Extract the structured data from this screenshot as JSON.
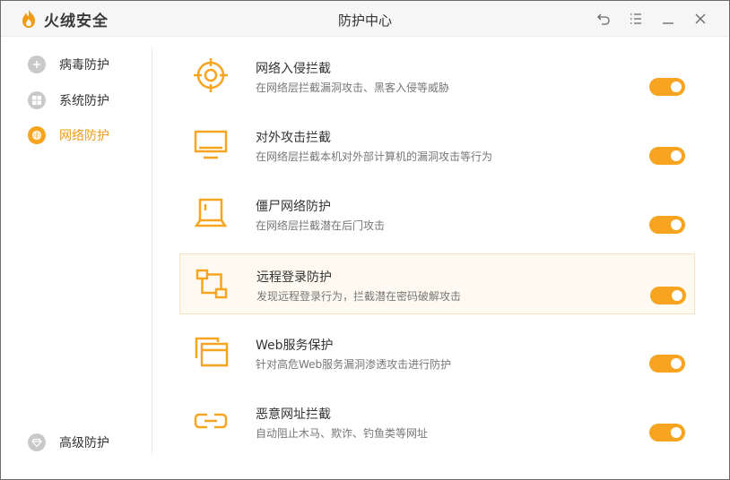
{
  "app": {
    "brand": "火绒安全",
    "title": "防护中心"
  },
  "window_controls": [
    "back-icon",
    "menu-icon",
    "minimize-icon",
    "close-icon"
  ],
  "colors": {
    "accent": "#f7a521",
    "inactive_icon": "#c9c9c9"
  },
  "sidebar": {
    "items": [
      {
        "label": "病毒防护",
        "icon": "virus-shield-icon",
        "active": false
      },
      {
        "label": "系统防护",
        "icon": "windows-icon",
        "active": false
      },
      {
        "label": "网络防护",
        "icon": "globe-icon",
        "active": true
      }
    ],
    "bottom_item": {
      "label": "高级防护",
      "icon": "diamond-icon",
      "active": false
    }
  },
  "rows": [
    {
      "title": "网络入侵拦截",
      "desc": "在网络层拦截漏洞攻击、黑客入侵等威胁",
      "icon": "crosshair-icon",
      "enabled": true
    },
    {
      "title": "对外攻击拦截",
      "desc": "在网络层拦截本机对外部计算机的漏洞攻击等行为",
      "icon": "monitor-icon",
      "enabled": true
    },
    {
      "title": "僵尸网络防护",
      "desc": "在网络层拦截潜在后门攻击",
      "icon": "laptop-icon",
      "enabled": true
    },
    {
      "title": "远程登录防护",
      "desc": "发现远程登录行为，拦截潜在密码破解攻击",
      "icon": "remote-connection-icon",
      "enabled": true,
      "highlighted": true
    },
    {
      "title": "Web服务保护",
      "desc": "针对高危Web服务漏洞渗透攻击进行防护",
      "icon": "web-windows-icon",
      "enabled": true
    },
    {
      "title": "恶意网址拦截",
      "desc": "自动阻止木马、欺诈、钓鱼类等网址",
      "icon": "link-icon",
      "enabled": true
    }
  ]
}
